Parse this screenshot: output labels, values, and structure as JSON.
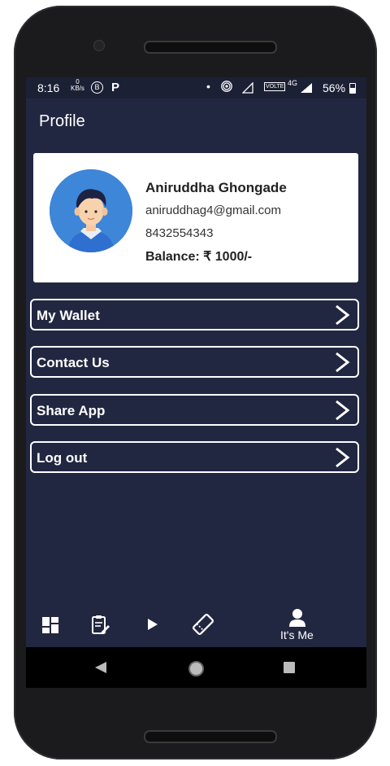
{
  "status_bar": {
    "time": "8:16",
    "net_speed_value": "0",
    "net_speed_unit": "KB/s",
    "b_icon_letter": "B",
    "p_icon_letter": "P",
    "volte_label": "VOLTE",
    "network_type": "4G",
    "battery_percent": "56%"
  },
  "header": {
    "title": "Profile"
  },
  "profile": {
    "name": "Aniruddha Ghongade",
    "email": "aniruddhag4@gmail.com",
    "phone": "8432554343",
    "balance": "Balance: ₹ 1000/-"
  },
  "menu": [
    {
      "label": "My Wallet"
    },
    {
      "label": "Contact Us"
    },
    {
      "label": "Share App"
    },
    {
      "label": "Log out"
    }
  ],
  "bottom_nav": {
    "items": [
      "dashboard-icon",
      "clipboard-edit-icon",
      "play-icon",
      "ticket-icon",
      "user-icon"
    ],
    "profile_label": "It's Me"
  },
  "colors": {
    "background": "#222741",
    "card": "#ffffff",
    "avatar_bg": "#3d86d8",
    "menu_border": "#ffffff"
  }
}
